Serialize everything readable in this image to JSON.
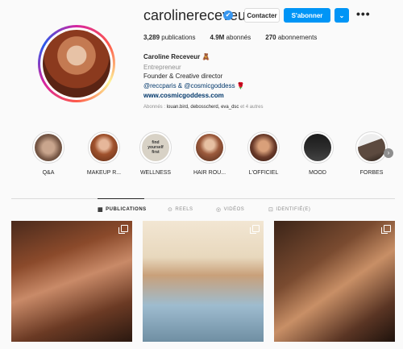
{
  "profile": {
    "username": "carolinereceveur",
    "verified_glyph": "✔",
    "buttons": {
      "contact": "Contacter",
      "follow": "S'abonner",
      "suggest_glyph": "⌄",
      "more_glyph": "•••"
    },
    "stats": {
      "posts_count": "3,289",
      "posts_label": "publications",
      "followers_count": "4.9M",
      "followers_label": "abonnés",
      "following_count": "270",
      "following_label": "abonnements"
    },
    "name": "Caroline Receveur 🧸",
    "category": "Entrepreneur",
    "bio": "Founder & Creative director",
    "mentions": "@reccparis & @cosmicgoddess 🌹",
    "website": "www.cosmicgoddess.com",
    "followed_by": {
      "prefix": "Abonnés : ",
      "accounts": "louan.bird, debosscherd, eva_dsc",
      "suffix": " et 4 autres"
    }
  },
  "highlights": [
    {
      "label": "Q&A",
      "color": "#8a6d5c"
    },
    {
      "label": "MAKEUP R...",
      "color": "#a0522d"
    },
    {
      "label": "WELLNESS",
      "color": "#d8d2c6",
      "inner_text": "find yourself first"
    },
    {
      "label": "HAIR ROU...",
      "color": "#9c5a3c"
    },
    {
      "label": "L'OFFICIEL",
      "color": "#6b3b2a"
    },
    {
      "label": "MOOD",
      "color": "#2b2b2b"
    },
    {
      "label": "FORBES",
      "color": "#5c4a3f"
    }
  ],
  "highlights_next_glyph": "›",
  "tabs": [
    {
      "label": "PUBLICATIONS",
      "icon": "grid-icon",
      "glyph": "▦",
      "active": true
    },
    {
      "label": "REELS",
      "icon": "reels-icon",
      "glyph": "⊙",
      "active": false
    },
    {
      "label": "VIDÉOS",
      "icon": "video-icon",
      "glyph": "◎",
      "active": false
    },
    {
      "label": "IDENTIFIÉ(E)",
      "icon": "tagged-icon",
      "glyph": "⊡",
      "active": false
    }
  ]
}
